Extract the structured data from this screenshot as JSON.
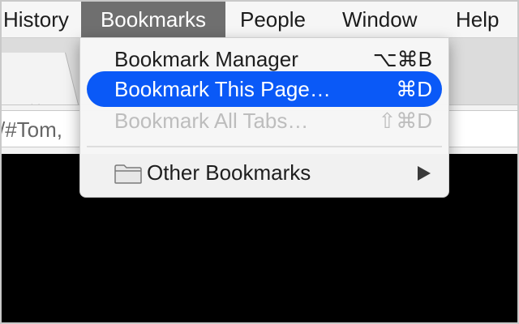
{
  "menubar": {
    "items": [
      {
        "label": "History"
      },
      {
        "label": "Bookmarks"
      },
      {
        "label": "People"
      },
      {
        "label": "Window"
      },
      {
        "label": "Help"
      }
    ]
  },
  "browser": {
    "tab_close": "×",
    "address_text": "/#Tom,"
  },
  "bookmarks_menu": {
    "items": [
      {
        "label": "Bookmark Manager",
        "shortcut": "⌥⌘B",
        "enabled": true
      },
      {
        "label": "Bookmark This Page…",
        "shortcut": "⌘D",
        "enabled": true,
        "highlighted": true
      },
      {
        "label": "Bookmark All Tabs…",
        "shortcut": "⇧⌘D",
        "enabled": false
      },
      {
        "label": "Other Bookmarks",
        "icon": "folder-icon",
        "submenu": true
      }
    ]
  },
  "colors": {
    "highlight": "#0a59f7",
    "active_menu": "#6f6f6f",
    "content": "#000000"
  }
}
